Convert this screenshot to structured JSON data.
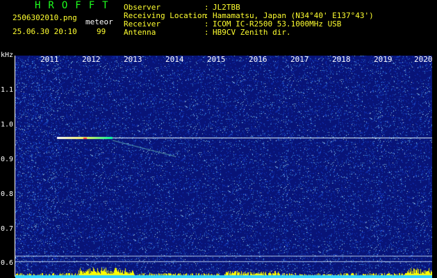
{
  "header": {
    "title": "HROFFT",
    "filename": "2506302010.png",
    "timestamp": "25.06.30 20:10",
    "meteor_label": "meteor",
    "meteor_count": "99",
    "fields": [
      {
        "label": "Observer",
        "sep": ":",
        "value": "JL2TBB"
      },
      {
        "label": "Receiving Location",
        "sep": ":",
        "value": "Hamamatsu, Japan (N34°40' E137°43')"
      },
      {
        "label": "Receiver",
        "sep": ":",
        "value": "ICOM IC-R2500 53.1000MHz USB"
      },
      {
        "label": "Antenna",
        "sep": ":",
        "value": "HB9CV Zenith dir."
      }
    ]
  },
  "spectrogram": {
    "unit_label": "kHz",
    "years": [
      "2011",
      "2012",
      "2013",
      "2014",
      "2015",
      "2016",
      "2017",
      "2018",
      "2019",
      "2020"
    ],
    "freq_labels": [
      "1.1",
      "1.0",
      "0.9",
      "0.8",
      "0.7",
      "0.6"
    ],
    "background_color": "#0a1a8c",
    "signal_color": "#ffffff",
    "meteor_color": "#ffff00"
  }
}
